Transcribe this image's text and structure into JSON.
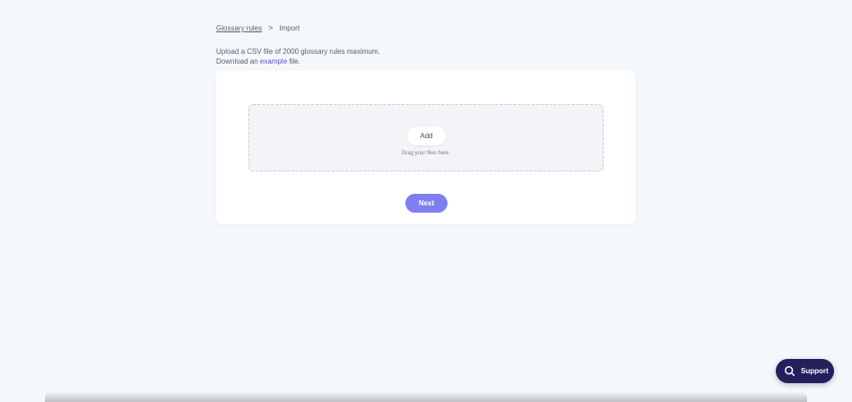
{
  "breadcrumb": {
    "parent": "Glossary rules",
    "separator": ">",
    "current": "Import"
  },
  "intro": {
    "line1": "Upload a CSV file of 2000 glossary rules maximum.",
    "line2_prefix": "Download an ",
    "line2_link": "example",
    "line2_suffix": " file."
  },
  "dropzone": {
    "add_label": "Add",
    "hint": "Drag your files here."
  },
  "actions": {
    "next_label": "Next"
  },
  "support": {
    "label": "Support",
    "icon": "search-icon"
  },
  "colors": {
    "accent": "#7f7ef0",
    "link": "#5a53d6",
    "support_bg": "#24205c",
    "background": "#f4f7fb"
  }
}
